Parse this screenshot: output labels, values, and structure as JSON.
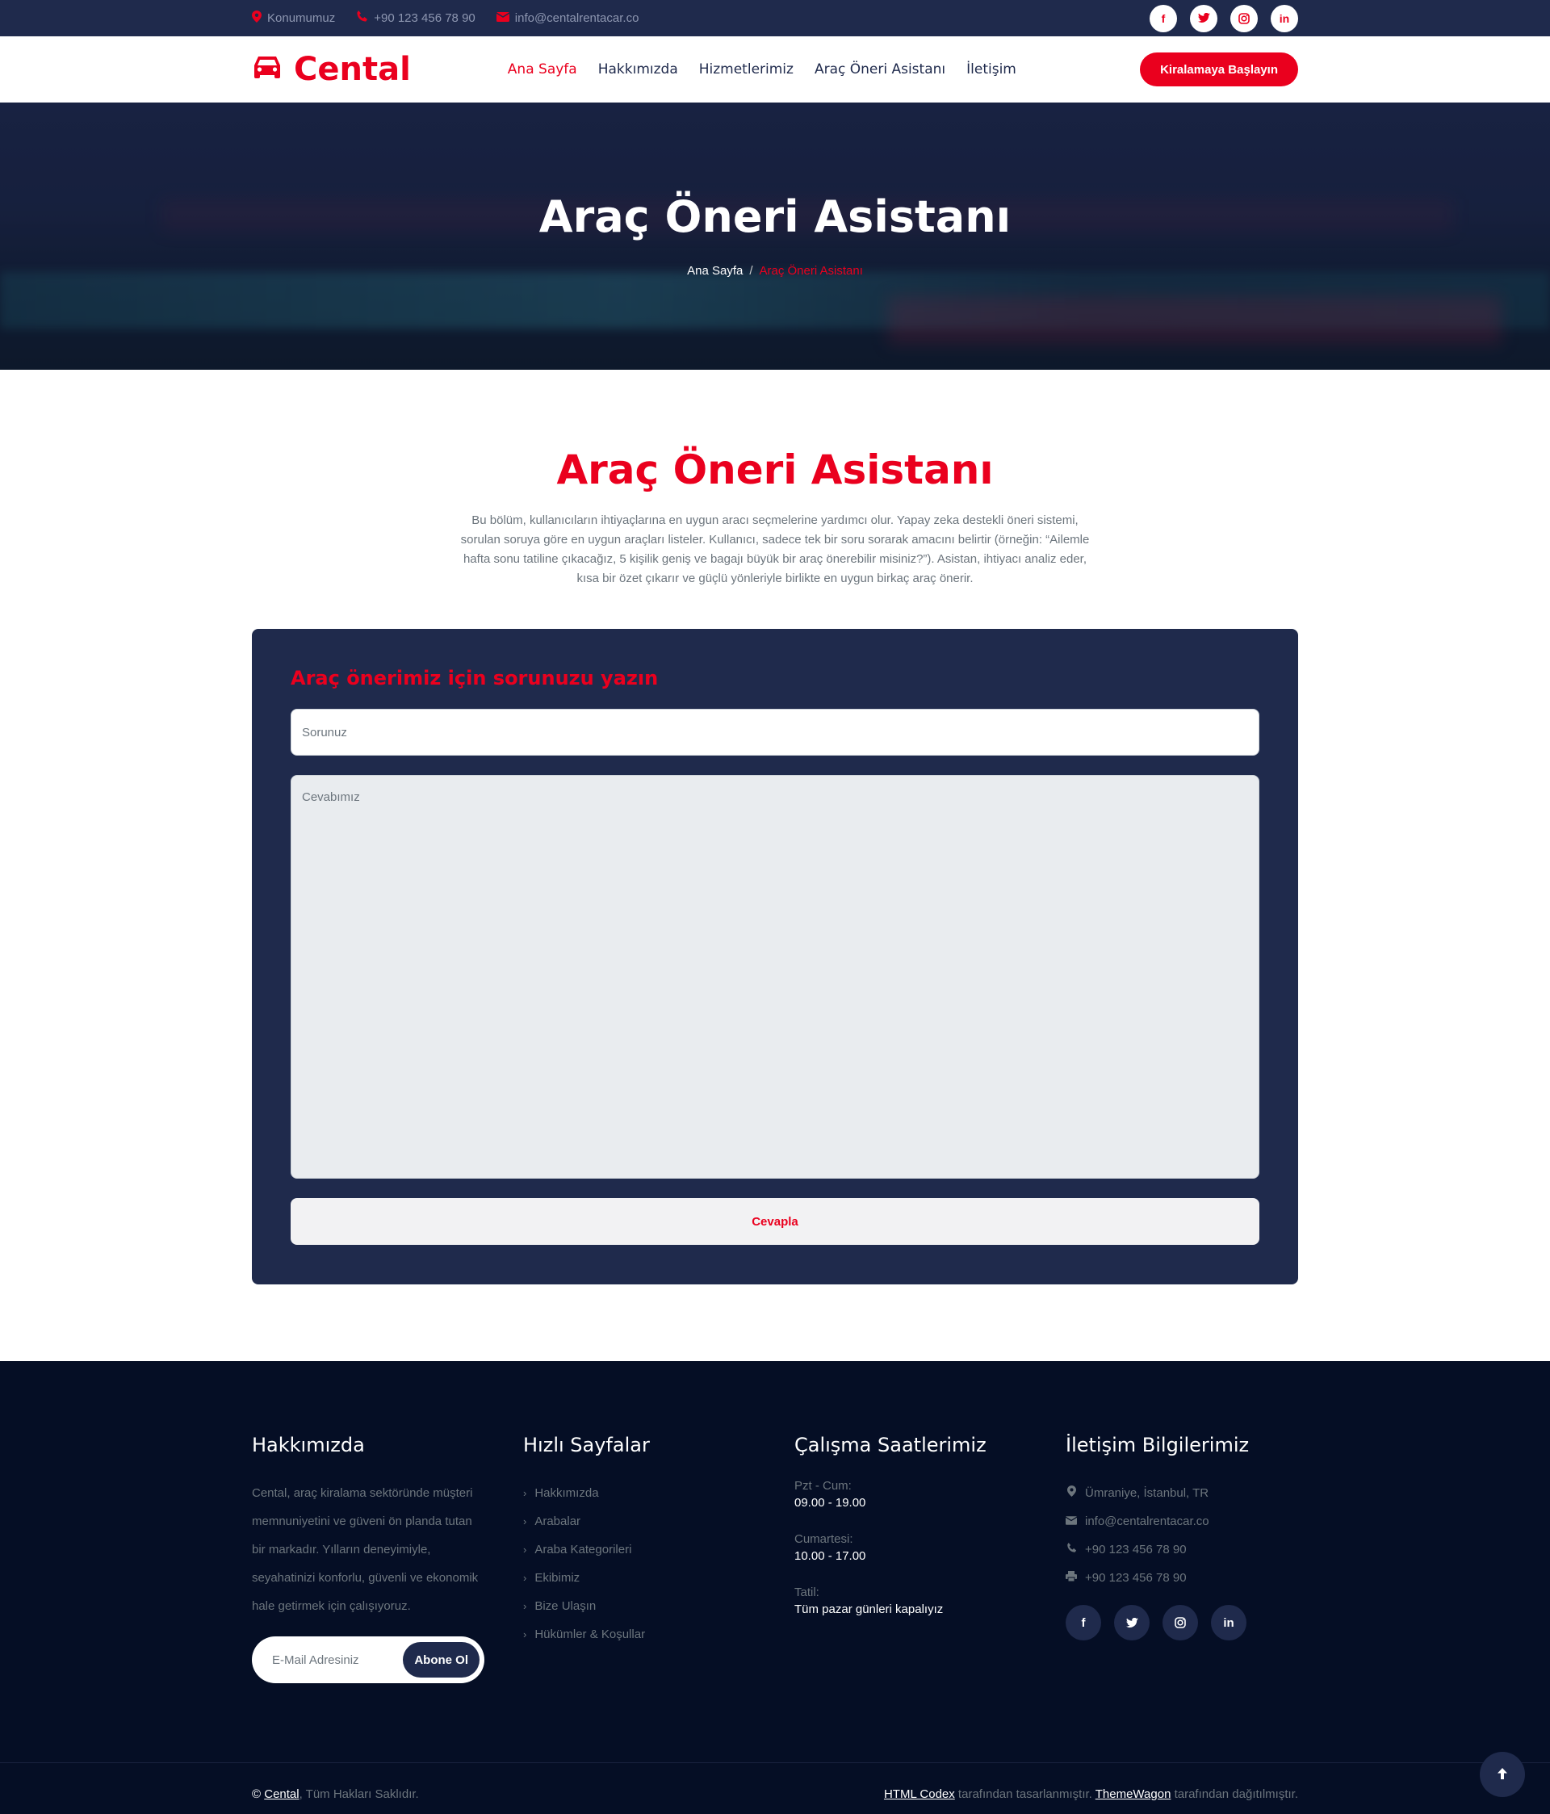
{
  "topbar": {
    "location": "Konumumuz",
    "phone": "+90 123 456 78 90",
    "email": "info@centalrentacar.co",
    "social_icons": [
      "facebook-icon",
      "twitter-icon",
      "instagram-icon",
      "linkedin-icon"
    ]
  },
  "brand": {
    "name": "Cental",
    "color": "#ea001e"
  },
  "nav": {
    "items": [
      {
        "label": "Ana Sayfa",
        "active": true
      },
      {
        "label": "Hakkımızda",
        "active": false
      },
      {
        "label": "Hizmetlerimiz",
        "active": false
      },
      {
        "label": "Araç Öneri Asistanı",
        "active": false
      },
      {
        "label": "İletişim",
        "active": false
      }
    ],
    "cta": "Kiralamaya Başlayın"
  },
  "hero": {
    "title": "Araç Öneri Asistanı",
    "breadcrumb_home": "Ana Sayfa",
    "breadcrumb_sep": "/",
    "breadcrumb_current": "Araç Öneri Asistanı"
  },
  "main": {
    "title": "Araç Öneri Asistanı",
    "description": "Bu bölüm, kullanıcıların ihtiyaçlarına en uygun aracı seçmelerine yardımcı olur. Yapay zeka destekli öneri sistemi, sorulan soruya göre en uygun araçları listeler. Kullanıcı, sadece tek bir soru sorarak amacını belirtir (örneğin: “Ailemle hafta sonu tatiline çıkacağız, 5 kişilik geniş ve bagajı büyük bir araç önerebilir misiniz?”). Asistan, ihtiyacı analiz eder, kısa bir özet çıkarır ve güçlü yönleriyle birlikte en uygun birkaç araç önerir."
  },
  "form": {
    "title": "Araç önerimiz için sorunuzu yazın",
    "question_placeholder": "Sorunuz",
    "answer_placeholder": "Cevabımız",
    "submit": "Cevapla"
  },
  "footer": {
    "about": {
      "title": "Hakkımızda",
      "text": "Cental, araç kiralama sektöründe müşteri memnuniyetini ve güveni ön planda tutan bir markadır. Yılların deneyimiyle, seyahatinizi konforlu, güvenli ve ekonomik hale getirmek için çalışıyoruz.",
      "email_placeholder": "E-Mail Adresiniz",
      "subscribe": "Abone Ol"
    },
    "quick": {
      "title": "Hızlı Sayfalar",
      "links": [
        "Hakkımızda",
        "Arabalar",
        "Araba Kategorileri",
        "Ekibimiz",
        "Bize Ulaşın",
        "Hükümler & Koşullar"
      ]
    },
    "hours": {
      "title": "Çalışma Saatlerimiz",
      "rows": [
        {
          "label": "Pzt - Cum:",
          "value": "09.00 - 19.00"
        },
        {
          "label": "Cumartesi:",
          "value": "10.00 - 17.00"
        },
        {
          "label": "Tatil:",
          "value": "Tüm pazar günleri kapalıyız"
        }
      ]
    },
    "contact": {
      "title": "İletişim Bilgilerimiz",
      "address": "Ümraniye, İstanbul, TR",
      "email": "info@centalrentacar.co",
      "phone": "+90 123 456 78 90",
      "fax": "+90 123 456 78 90"
    }
  },
  "copyright": {
    "brand": "Cental",
    "rights": ", Tüm Hakları Saklıdır.",
    "designer": "HTML Codex",
    "designed_text": " tarafından tasarlanmıştır. ",
    "distributor": "ThemeWagon",
    "distributed_text": " tarafından dağıtılmıştır."
  }
}
